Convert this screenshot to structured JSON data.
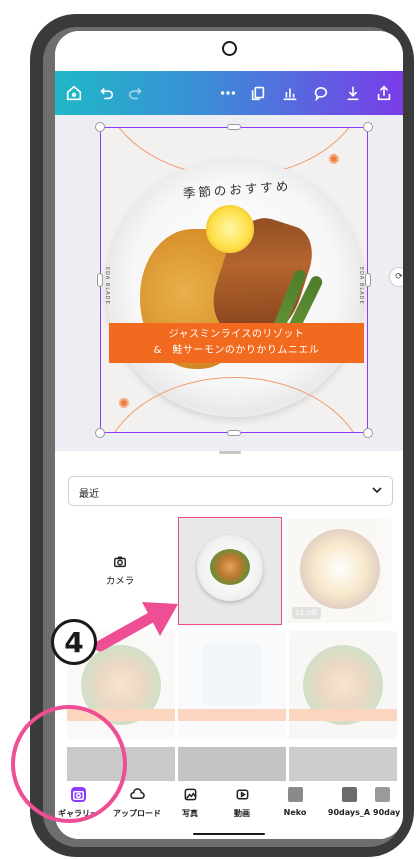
{
  "toolbar": {
    "icons": [
      "home-icon",
      "undo-icon",
      "redo-icon",
      "more-icon",
      "copy-icon",
      "chart-icon",
      "comment-icon",
      "download-icon",
      "share-icon"
    ]
  },
  "design": {
    "title": "季節のおすすめ",
    "banner_line1": "ジャスミンライスのリゾット",
    "banner_line2": "&　鮭サーモンのかりかりムニエル",
    "side_left": "EDA BLADE",
    "side_right": "EDA BLADE"
  },
  "panel": {
    "dropdown_label": "最近",
    "camera_label": "カメラ",
    "price_tag": "15.0件"
  },
  "tabs": [
    {
      "label": "ギャラリー",
      "icon": "gallery-icon",
      "active": true
    },
    {
      "label": "アップロード",
      "icon": "upload-icon",
      "active": false
    },
    {
      "label": "写真",
      "icon": "photo-icon",
      "active": false
    },
    {
      "label": "動画",
      "icon": "video-icon",
      "active": false
    },
    {
      "label": "Neko",
      "icon": "folder-thumb-icon",
      "active": false
    },
    {
      "label": "90days_A",
      "icon": "folder-thumb-icon",
      "active": false
    },
    {
      "label": "90day",
      "icon": "folder-thumb-icon",
      "active": false
    }
  ],
  "annotation": {
    "step_number": "4"
  },
  "colors": {
    "accent_purple": "#8b3dff",
    "highlight_pink": "#ee4e94",
    "banner_orange": "#f26a1f"
  }
}
